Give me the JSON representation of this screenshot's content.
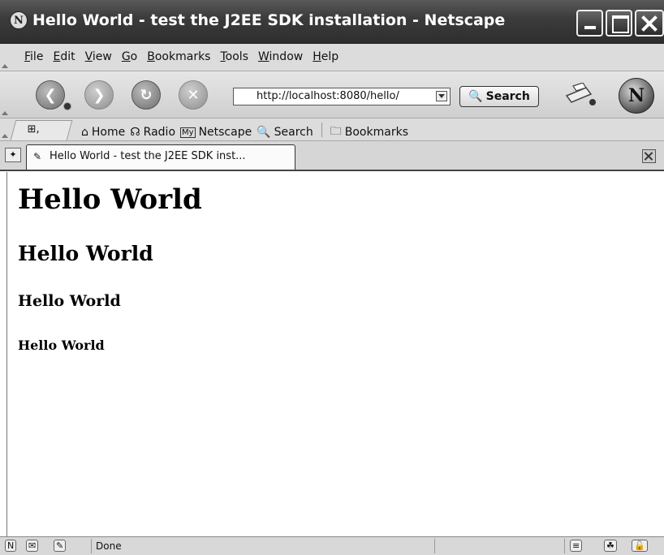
{
  "window": {
    "title": "Hello World - test the J2EE SDK installation - Netscape",
    "app_icon_letter": "N"
  },
  "menubar": {
    "items": [
      {
        "accel": "F",
        "rest": "ile"
      },
      {
        "accel": "E",
        "rest": "dit"
      },
      {
        "accel": "V",
        "rest": "iew"
      },
      {
        "accel": "G",
        "rest": "o"
      },
      {
        "accel": "B",
        "rest": "ookmarks"
      },
      {
        "accel": "T",
        "rest": "ools"
      },
      {
        "accel": "W",
        "rest": "indow"
      },
      {
        "accel": "H",
        "rest": "elp"
      }
    ]
  },
  "navbar": {
    "url": "http://localhost:8080/hello/",
    "search_label": "Search",
    "throbber_letter": "N"
  },
  "personal_toolbar": {
    "home": "Home",
    "radio": "Radio",
    "my_icon": "My",
    "netscape": "Netscape",
    "search": "Search",
    "bookmarks": "Bookmarks"
  },
  "tab": {
    "title": "Hello World - test the J2EE SDK inst..."
  },
  "content": {
    "h1": "Hello World",
    "h2": "Hello World",
    "h3": "Hello World",
    "h4": "Hello World"
  },
  "statusbar": {
    "text": "Done"
  },
  "icons": [
    "netscape-icon",
    "back-icon",
    "forward-icon",
    "reload-icon",
    "stop-icon",
    "print-icon",
    "throbber-icon",
    "home-icon",
    "radio-icon",
    "search-icon",
    "bookmarks-icon",
    "new-tab-icon",
    "page-icon",
    "close-tab-icon"
  ]
}
